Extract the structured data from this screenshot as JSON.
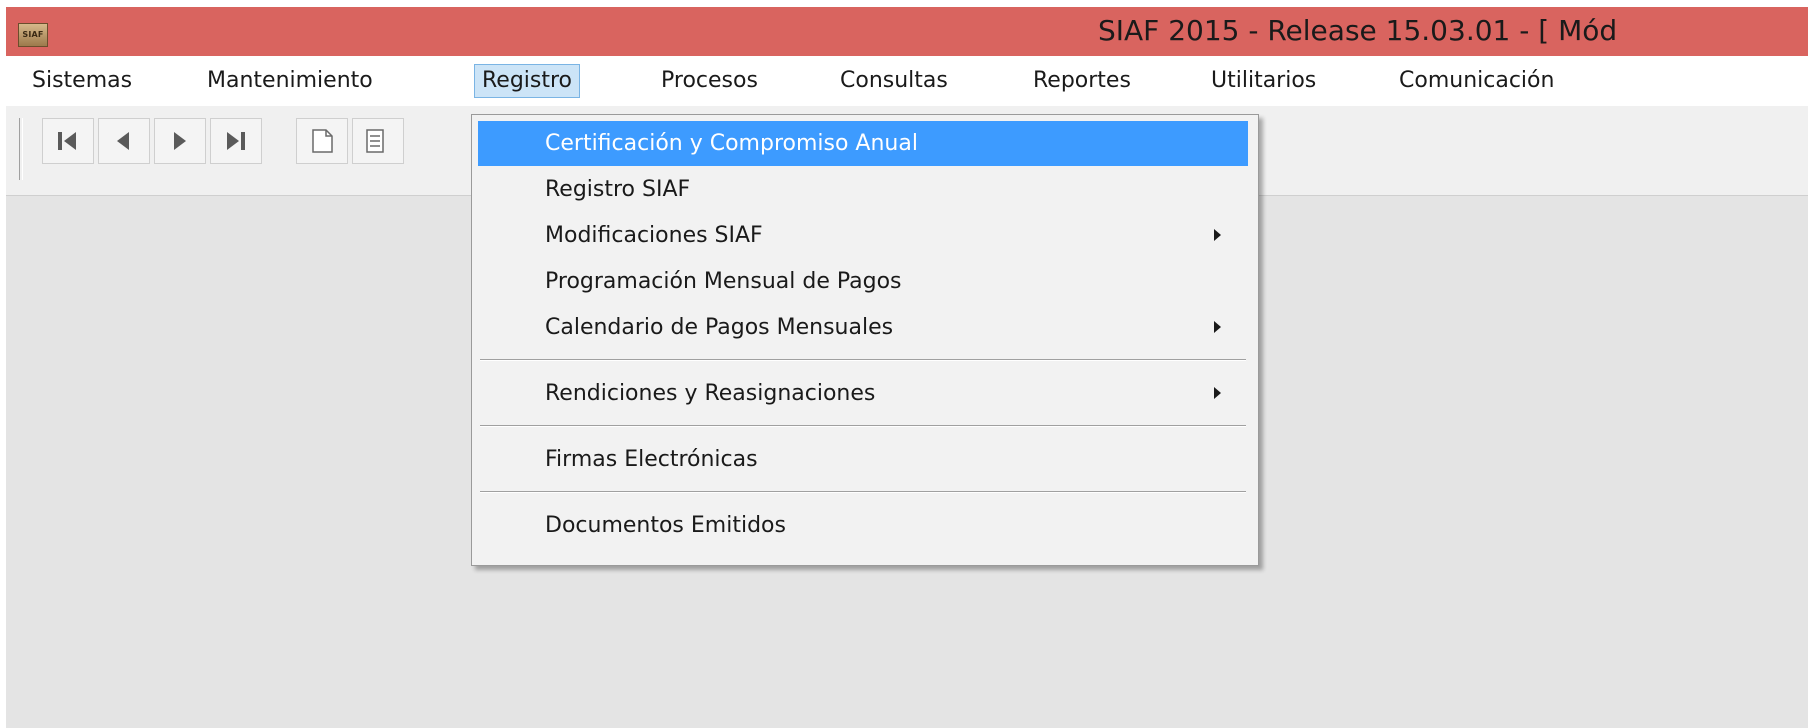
{
  "window": {
    "app_icon_text": "SIAF",
    "title": "SIAF 2015 - Release 15.03.01 - [ Mód"
  },
  "menubar": {
    "items": [
      {
        "label": "Sistemas"
      },
      {
        "label": "Mantenimiento"
      },
      {
        "label": "Registro"
      },
      {
        "label": "Procesos"
      },
      {
        "label": "Consultas"
      },
      {
        "label": "Reportes"
      },
      {
        "label": "Utilitarios"
      },
      {
        "label": "Comunicación"
      }
    ],
    "active": "Registro"
  },
  "toolbar": {
    "icons": [
      "first-record-icon",
      "previous-record-icon",
      "next-record-icon",
      "last-record-icon",
      "new-document-icon"
    ]
  },
  "dropdown": {
    "items": [
      {
        "label": "Certificación y Compromiso Anual",
        "highlighted": true,
        "submenu": false
      },
      {
        "label": "Registro SIAF",
        "submenu": false
      },
      {
        "label": "Modificaciones SIAF",
        "submenu": true
      },
      {
        "label": "Programación Mensual de Pagos",
        "submenu": false
      },
      {
        "label": "Calendario de Pagos Mensuales",
        "submenu": true
      },
      {
        "label": "Rendiciones y Reasignaciones",
        "submenu": true
      },
      {
        "label": "Firmas Electrónicas",
        "submenu": false
      },
      {
        "label": "Documentos Emitidos",
        "submenu": false
      }
    ]
  },
  "colors": {
    "titlebar": "#d9645f",
    "menu_highlight": "#3d9bff",
    "active_menu_bg": "#cce4f7"
  }
}
